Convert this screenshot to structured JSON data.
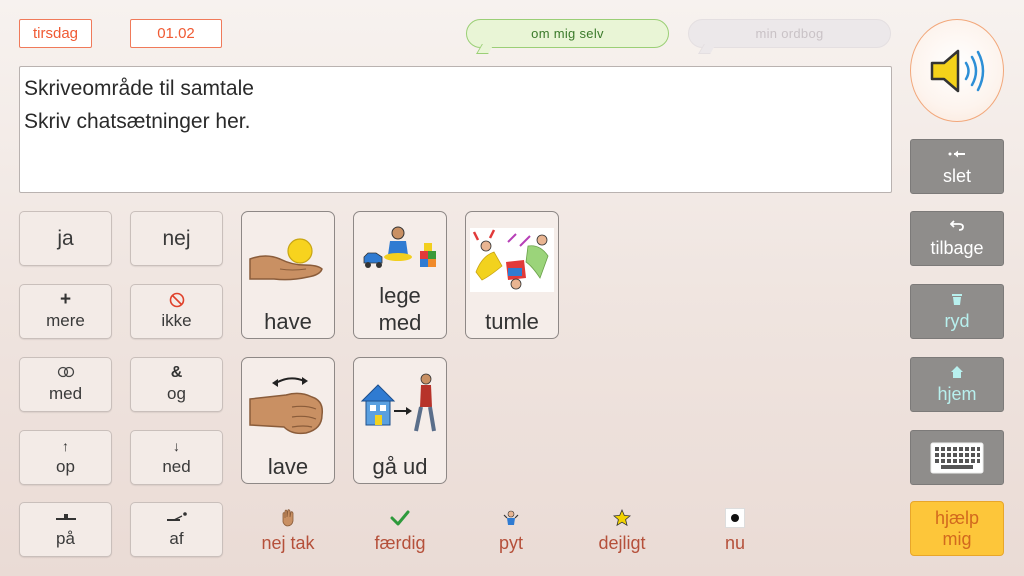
{
  "top": {
    "day": "tirsdag",
    "date": "01.02",
    "about_me": "om mig selv",
    "my_dictionary": "min ordbog"
  },
  "writing_area": {
    "line1": "Skriveområde til samtale",
    "line2": "Skriv chatsætninger her."
  },
  "small_buttons": [
    {
      "label": "ja",
      "icon": ""
    },
    {
      "label": "nej",
      "icon": ""
    },
    {
      "label": "mere",
      "icon": "plus-icon"
    },
    {
      "label": "ikke",
      "icon": "no-entry-icon"
    },
    {
      "label": "med",
      "icon": "linked-rings-icon"
    },
    {
      "label": "og",
      "icon": "ampersand-icon"
    },
    {
      "label": "op",
      "icon": "arrow-up-icon"
    },
    {
      "label": "ned",
      "icon": "arrow-down-icon"
    },
    {
      "label": "på",
      "icon": "on-surface-icon"
    },
    {
      "label": "af",
      "icon": "off-surface-icon"
    }
  ],
  "cards": [
    {
      "label": "have",
      "icon": "hand-holding-ball-icon"
    },
    {
      "label": "lege med",
      "icon": "child-playing-toys-icon"
    },
    {
      "label": "tumle",
      "icon": "children-tumbling-icon"
    },
    {
      "label": "lave",
      "icon": "fist-action-icon"
    },
    {
      "label": "gå ud",
      "icon": "walk-out-of-house-icon"
    }
  ],
  "bottom_row": [
    {
      "label": "nej tak",
      "icon": "raised-hand-icon"
    },
    {
      "label": "færdig",
      "icon": "checkmark-icon",
      "color": "#2e9a3c"
    },
    {
      "label": "pyt",
      "icon": "shrug-person-icon"
    },
    {
      "label": "dejligt",
      "icon": "star-icon",
      "color": "#f2d200"
    },
    {
      "label": "nu",
      "icon": "dot-icon"
    }
  ],
  "right_panel": {
    "speaker_icon": "speaker-icon",
    "delete": "slet",
    "undo": "tilbage",
    "clear": "ryd",
    "home": "hjem",
    "keyboard_icon": "keyboard-icon",
    "help": "hjælp mig"
  },
  "colors": {
    "accent_orange": "#f05a33",
    "bubble_green": "#9bcf76",
    "gray_button": "#8f8d8b",
    "help_yellow": "#fdc63a",
    "home_icon": "#b8f0ee"
  }
}
